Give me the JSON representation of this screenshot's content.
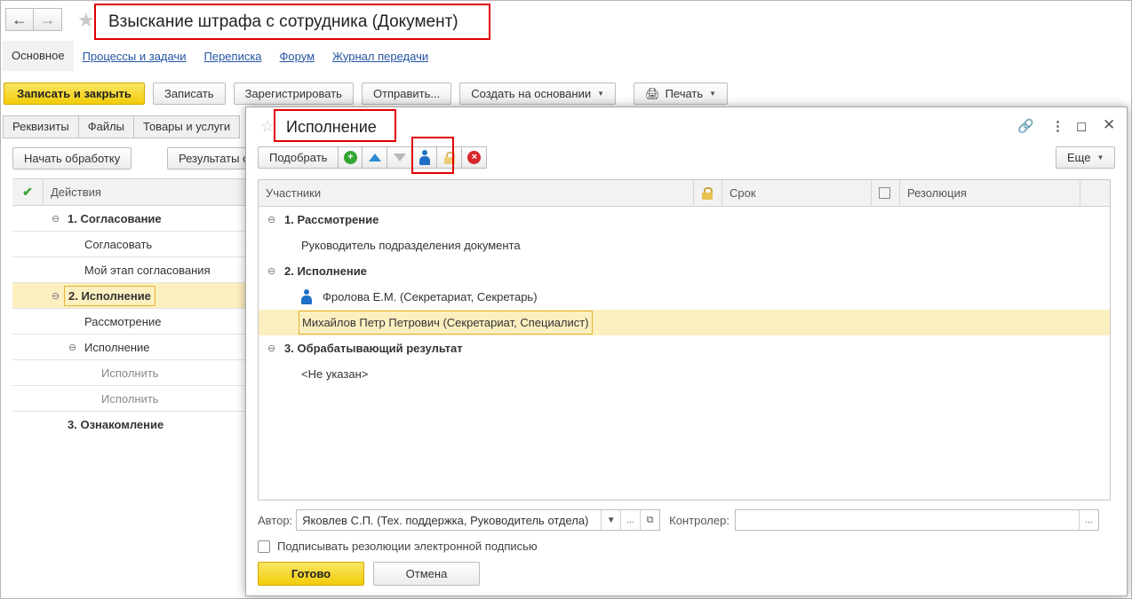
{
  "window": {
    "title": "Взыскание штрафа с сотрудника (Документ)",
    "sections": [
      "Основное",
      "Процессы и задачи",
      "Переписка",
      "Форум",
      "Журнал передачи"
    ]
  },
  "toolbar": {
    "save_close": "Записать и закрыть",
    "save": "Записать",
    "register": "Зарегистрировать",
    "send": "Отправить...",
    "create_based": "Создать на основании",
    "print": "Печать"
  },
  "tabs": [
    "Реквизиты",
    "Файлы",
    "Товары и услуги"
  ],
  "actions": {
    "start_label": "Начать обработку",
    "results_label": "Результаты о"
  },
  "left_grid": {
    "header": "Действия",
    "rows": [
      {
        "label": "1. Согласование"
      },
      {
        "label": "Согласовать"
      },
      {
        "label": "Мой этап согласования"
      },
      {
        "label": "2. Исполнение"
      },
      {
        "label": "Рассмотрение"
      },
      {
        "label": "Исполнение"
      },
      {
        "label": "Исполнить"
      },
      {
        "label": "Исполнить"
      },
      {
        "label": "3. Ознакомление"
      }
    ]
  },
  "modal": {
    "title": "Исполнение",
    "pick_label": "Подобрать",
    "more_label": "Еще",
    "columns": {
      "participants": "Участники",
      "deadline": "Срок",
      "resolution": "Резолюция"
    },
    "rows": [
      {
        "label": "1. Рассмотрение"
      },
      {
        "label": "Руководитель подразделения документа"
      },
      {
        "label": "2. Исполнение"
      },
      {
        "label": "Фролова Е.М. (Секретариат, Секретарь)"
      },
      {
        "label": "Михайлов Петр Петрович (Секретариат, Специалист)"
      },
      {
        "label": "3. Обрабатывающий результат"
      },
      {
        "label": "<Не указан>"
      }
    ],
    "author_label": "Автор:",
    "author_value": "Яковлев С.П. (Тех. поддержка, Руководитель отдела)",
    "controller_label": "Контролер:",
    "controller_value": "",
    "sign_label": "Подписывать резолюции электронной подписью",
    "done_label": "Готово",
    "cancel_label": "Отмена"
  },
  "colors": {
    "accent_yellow": "#f5d21a",
    "highlight_red": "#e00000",
    "selection": "#fcefc0",
    "link": "#2554a4"
  },
  "icons": [
    "back-arrow-icon",
    "forward-arrow-icon",
    "star-icon",
    "printer-icon",
    "add-icon",
    "move-up-icon",
    "move-down-icon",
    "person-icon",
    "lock-icon",
    "delete-icon",
    "link-icon",
    "more-vertical-icon",
    "maximize-icon",
    "close-icon",
    "check-icon",
    "resolution-icon"
  ]
}
